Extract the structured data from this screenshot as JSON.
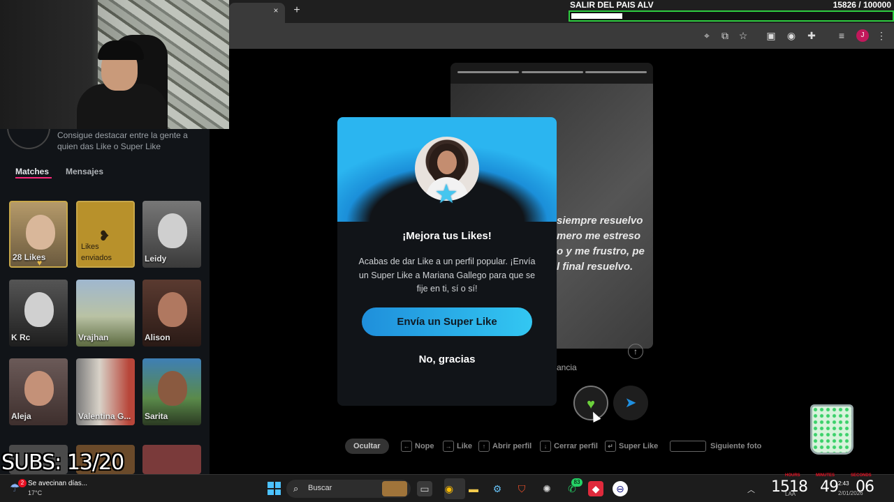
{
  "browser": {
    "tab_close": "×",
    "new_tab": "+",
    "profile_initial": "J"
  },
  "goal": {
    "title": "SALIR DEL PAIS ALV",
    "count": "15826  / 100000",
    "progress": 0.158,
    "color": "#2ecc40"
  },
  "sidebar": {
    "promo_text": "Consigue destacar entre la gente a quien das Like o Super Like",
    "tabs": {
      "matches": "Matches",
      "mensajes": "Mensajes"
    },
    "likes_card": {
      "label": "28 Likes"
    },
    "sent_card": {
      "label_line1": "Likes",
      "label_line2": "enviados"
    },
    "matches": [
      {
        "name": "Leidy"
      },
      {
        "name": "K Rc"
      },
      {
        "name": "Vrajhan"
      },
      {
        "name": "Alison"
      },
      {
        "name": "Aleja"
      },
      {
        "name": "Valentina G..."
      },
      {
        "name": "Sarita"
      }
    ],
    "accent": "#fd267a"
  },
  "overlay": {
    "subs": "SUBS: 13/20"
  },
  "profile": {
    "quote": "siempre resuelvo\nmero me estreso\no y me frustro, pe\nl final resuelvo.",
    "distance_fragment": "ancia"
  },
  "modal": {
    "title": "¡Mejora tus Likes!",
    "body": "Acabas de dar Like a un perfil popular. ¡Envía un Super Like a Mariana Gallego para que se fije en ti, sí o sí!",
    "primary_button": "Envía un Super Like",
    "secondary_button": "No, gracias",
    "accent": "#2bb5f0"
  },
  "shortcuts": {
    "ocultar": "Ocultar",
    "nope": "Nope",
    "like": "Like",
    "abrir_perfil": "Abrir perfil",
    "cerrar_perfil": "Cerrar perfil",
    "super_like": "Super Like",
    "siguiente_foto": "Siguiente foto"
  },
  "taskbar": {
    "weather_title": "Se avecinan días...",
    "weather_temp": "17°C",
    "weather_badge": "2",
    "search_label": "Buscar",
    "whatsapp_badge": "83",
    "clock_hours": "1518",
    "clock_minutes": "49",
    "clock_seconds": "06",
    "clock_labels": [
      "HOURS",
      "MINUTES",
      "SECONDS"
    ],
    "time_small": "2:43",
    "date_small": "2/01/2026",
    "lang": "LAA"
  }
}
